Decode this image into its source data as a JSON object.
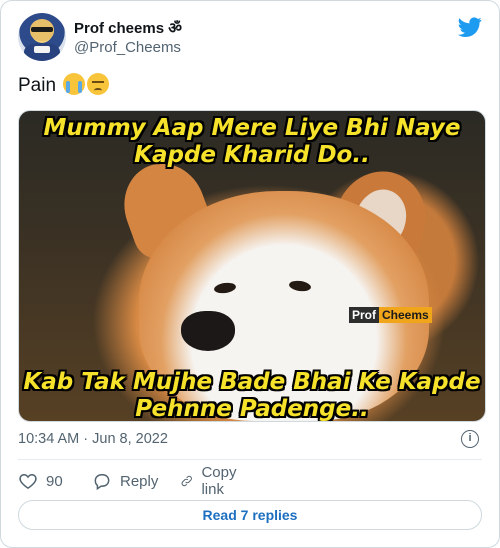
{
  "author": {
    "display_name": "Prof cheems ॐ",
    "handle": "@Prof_Cheems",
    "avatar_icon": "cheems-avatar"
  },
  "tweet": {
    "text": "Pain",
    "emojis": [
      "loudly-crying-face",
      "pensive-face"
    ]
  },
  "media": {
    "caption_top": "Mummy Aap Mere Liye Bhi Naye Kapde Kharid Do..",
    "caption_bottom": "Kab Tak Mujhe Bade Bhai Ke Kapde Pehnne Padenge..",
    "watermark_left": "Prof",
    "watermark_right": "Cheems",
    "caption_color": "#f6e22a"
  },
  "meta": {
    "timestamp": "10:34 AM · Jun 8, 2022"
  },
  "actions": {
    "like_count": "90",
    "reply_label": "Reply",
    "copy_label": "Copy link"
  },
  "footer": {
    "read_replies_label": "Read 7 replies"
  },
  "colors": {
    "brand": "#1d9bf0",
    "link": "#1d6fc0",
    "secondary_text": "#536471",
    "border": "#cfd9de"
  }
}
